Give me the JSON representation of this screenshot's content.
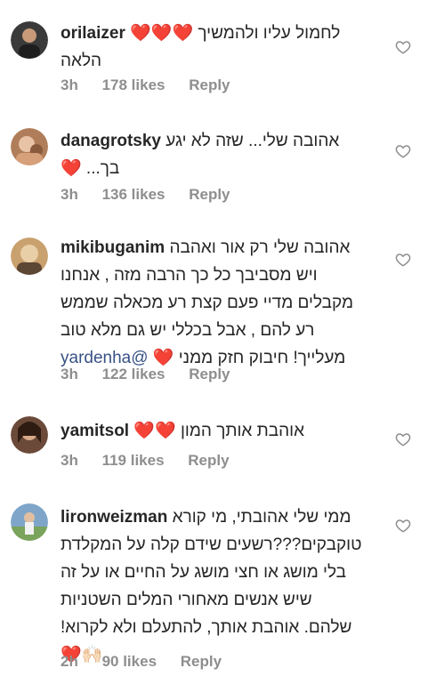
{
  "comments": [
    {
      "username": "orilaizer",
      "text": "לחמול עליו ולהמשיך ❤️❤️❤️",
      "text_line2": "הלאה",
      "time": "3h",
      "likes": "178 likes",
      "reply": "Reply",
      "avatar_color": "#3a3a3a"
    },
    {
      "username": "danagrotsky",
      "text": "אהובה שלי... שזה לא יגע",
      "text_line2": "בך... ❤️",
      "time": "3h",
      "likes": "136 likes",
      "reply": "Reply",
      "avatar_color": "#b07d5a"
    },
    {
      "username": "mikibuganim",
      "text": "אהובה שלי רק אור ואהבה",
      "text_line2": "ויש מסביבך כל כך הרבה מזה , אנחנו",
      "text_line3": "מקבלים מדיי פעם קצת רע מכאלה שממש",
      "text_line4": "רע להם , אבל בכללי יש גם מלא טוב",
      "text_line5_mention": "@yardenha",
      "text_line5": "מעלייך! חיבוק חזק ממני ❤️",
      "time": "3h",
      "likes": "122 likes",
      "reply": "Reply",
      "avatar_color": "#c9a16e"
    },
    {
      "username": "yamitsol",
      "text": "אוהבת אותך המון ❤️❤️",
      "time": "3h",
      "likes": "119 likes",
      "reply": "Reply",
      "avatar_color": "#6b4a3a"
    },
    {
      "username": "lironweizman",
      "text": "ממי שלי אהובתי, מי קורא",
      "text_line2": "טוקבקים???רשעים שידם קלה על המקלדת",
      "text_line3": "בלי מושג או חצי מושג על החיים או על זה",
      "text_line4": "שיש אנשים מאחורי המלים השטניות",
      "text_line5": "שלהם. אוהבת אותך, להתעלם ולא לקרוא!",
      "text_line6": "❤️🙌🏻",
      "time": "2h",
      "likes": "90 likes",
      "reply": "Reply",
      "avatar_color": "#7fa6c9"
    }
  ]
}
